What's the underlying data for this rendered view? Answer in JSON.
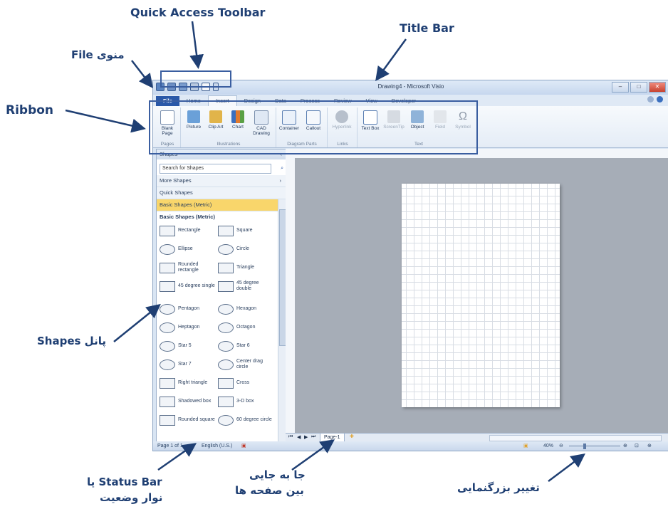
{
  "annotations": {
    "qat": "Quick Access Toolbar",
    "titlebar": "Title Bar",
    "file_menu": "منوی File",
    "ribbon": "Ribbon",
    "shapes_panel": "پانل Shapes",
    "statusbar_line1": "Status Bar یا",
    "statusbar_line2": "نوار وضعیت",
    "page_nav_line1": "جا به جایی",
    "page_nav_line2": "بین صفحه ها",
    "zoom": "تغییر بزرگنمایی"
  },
  "window": {
    "title": "Drawing4 - Microsoft Visio",
    "accent": "#2a58a8"
  },
  "tabs": [
    "File",
    "Home",
    "Insert",
    "Design",
    "Data",
    "Process",
    "Review",
    "View",
    "Developer"
  ],
  "active_tab": "Insert",
  "ribbon": {
    "groups": [
      {
        "label": "Pages",
        "buttons": [
          "Blank Page"
        ]
      },
      {
        "label": "Illustrations",
        "buttons": [
          "Picture",
          "Clip Art",
          "Chart",
          "CAD Drawing"
        ]
      },
      {
        "label": "Diagram Parts",
        "buttons": [
          "Container",
          "Callout"
        ]
      },
      {
        "label": "Links",
        "buttons": [
          "Hyperlink"
        ]
      },
      {
        "label": "Text",
        "buttons": [
          "Text Box",
          "ScreenTip",
          "Object",
          "Field",
          "Symbol"
        ]
      }
    ]
  },
  "shapes_panel": {
    "title": "Shapes",
    "search_placeholder": "Search for Shapes",
    "more_shapes": "More Shapes",
    "quick_shapes": "Quick Shapes",
    "selected_stencil": "Basic Shapes (Metric)",
    "subheader": "Basic Shapes (Metric)",
    "items": [
      "Rectangle",
      "Square",
      "Ellipse",
      "Circle",
      "Rounded rectangle",
      "Triangle",
      "45 degree single",
      "45 degree double",
      "Pentagon",
      "Hexagon",
      "Heptagon",
      "Octagon",
      "Star 5",
      "Star 6",
      "Star 7",
      "Center drag circle",
      "Right triangle",
      "Cross",
      "Shadowed box",
      "3-D box",
      "Rounded square",
      "60 degree circle"
    ]
  },
  "page_tab": "Page-1",
  "status": {
    "page": "Page 1 of 1",
    "language": "English (U.S.)",
    "zoom": "40%"
  }
}
